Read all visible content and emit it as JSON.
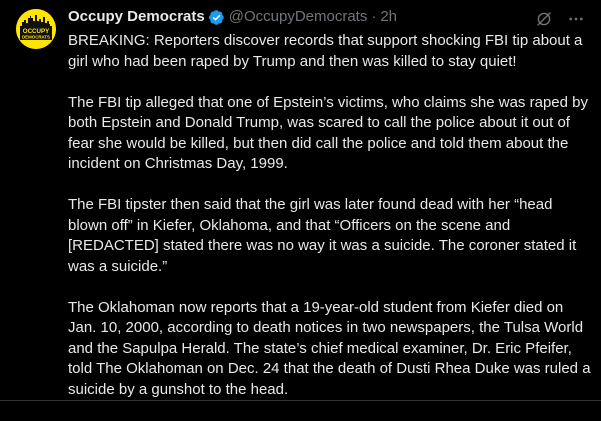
{
  "tweet": {
    "author": {
      "display_name": "Occupy Democrats",
      "handle": "@OccupyDemocrats",
      "verified": true,
      "avatar_text_top": "OCCUPY",
      "avatar_text_bottom": "DEMOCRATS"
    },
    "separator": "·",
    "timestamp": "2h",
    "paragraphs": [
      "BREAKING: Reporters discover records that support shocking FBI tip about a\ngirl who had been raped by Trump and then was killed to stay quiet!",
      "The FBI tip alleged that one of Epstein’s victims, who claims she was raped by\nboth Epstein and Donald Trump, was scared to call the police about it out of\nfear she would be killed, but then did call the police and told them about the\nincident on Christmas Day, 1999.",
      "The FBI tipster then said that the girl was later found dead with her “head\nblown off” in Kiefer, Oklahoma, and that “Officers on the scene and\n[REDACTED] stated there was no way it was a suicide. The coroner stated it\nwas a suicide.”",
      "The Oklahoman now reports that a 19-year-old student from Kiefer died on\nJan. 10, 2000, according to death notices in two newspapers, the Tulsa World\nand the Sapulpa Herald. The state’s chief medical examiner, Dr. Eric Pfeifer,\ntold The Oklahoman on Dec. 24 that the death of Dusti Rhea Duke was ruled a\nsuicide by a gunshot to the head."
    ]
  },
  "icons": {
    "grok": "grok-slash-icon",
    "more": "more-options-icon",
    "verified": "verified-badge-icon"
  },
  "colors": {
    "background": "#000000",
    "text": "#e7e9ea",
    "secondary": "#71767b",
    "verified_blue": "#1d9bf0",
    "avatar_yellow": "#ffe500"
  }
}
